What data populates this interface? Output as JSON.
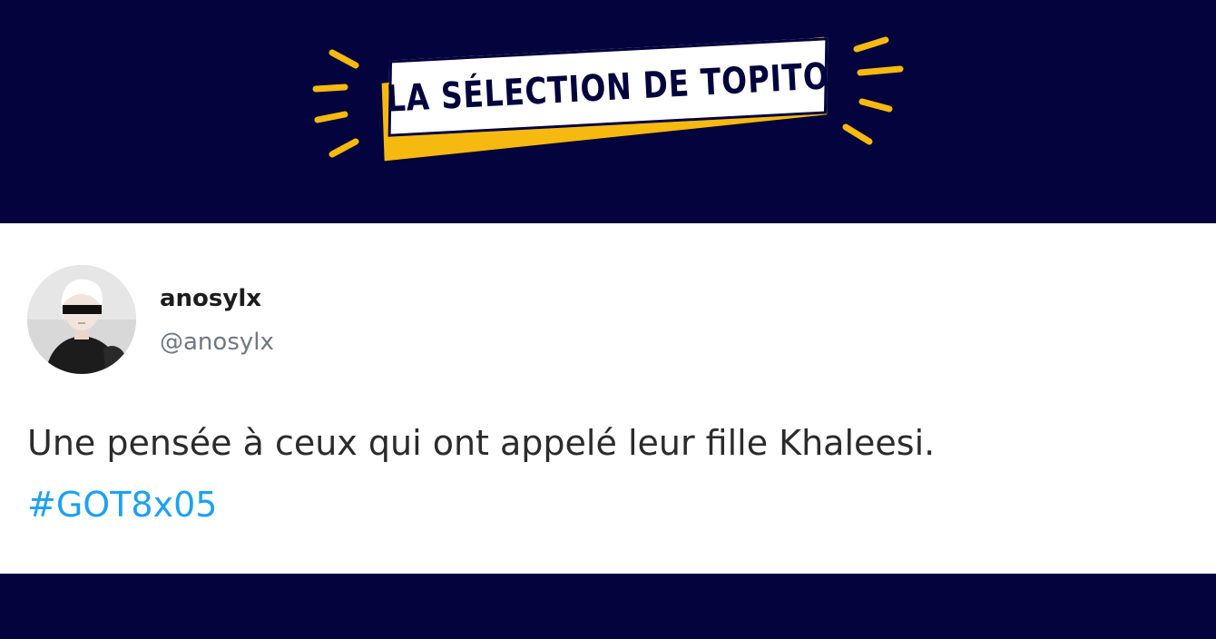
{
  "banner": {
    "title": "LA SÉLECTION DE TOPITO",
    "colors": {
      "background": "#03033d",
      "accent": "#f6b90f",
      "badge": "#ffffff"
    }
  },
  "tweet": {
    "display_name": "anosylx",
    "handle": "@anosylx",
    "text": "Une pensée à ceux qui ont appelé leur fille Khaleesi.",
    "hashtag": "#GOT8x05",
    "avatar_icon": "profile-photo-white-haired-character",
    "colors": {
      "hashtag": "#1da1f2",
      "handle": "#6e7882"
    }
  }
}
